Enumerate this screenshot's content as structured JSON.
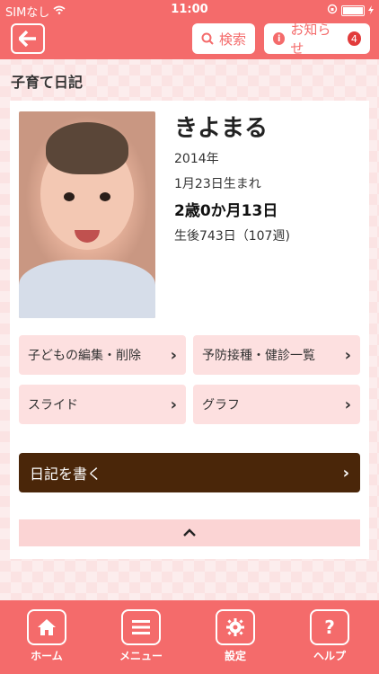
{
  "status_bar": {
    "carrier": "SIMなし",
    "time": "11:00"
  },
  "header": {
    "search_label": "検索",
    "notice_label": "お知らせ",
    "notice_count": "4"
  },
  "page": {
    "title": "子育て日記"
  },
  "child": {
    "name": "きよまる",
    "birth_year": "2014年",
    "birth_date": "1月23日生まれ",
    "age": "2歳0か月13日",
    "days": "生後743日（107週)"
  },
  "actions": {
    "edit": "子どもの編集・削除",
    "vaccination": "予防接種・健診一覧",
    "slide": "スライド",
    "graph": "グラフ",
    "write_diary": "日記を書く"
  },
  "tabbar": {
    "home": "ホーム",
    "menu": "メニュー",
    "settings": "設定",
    "help": "ヘルプ"
  },
  "colors": {
    "primary": "#f46b6b",
    "accent_dark": "#4a2609",
    "light_pink": "#fde0e0"
  }
}
